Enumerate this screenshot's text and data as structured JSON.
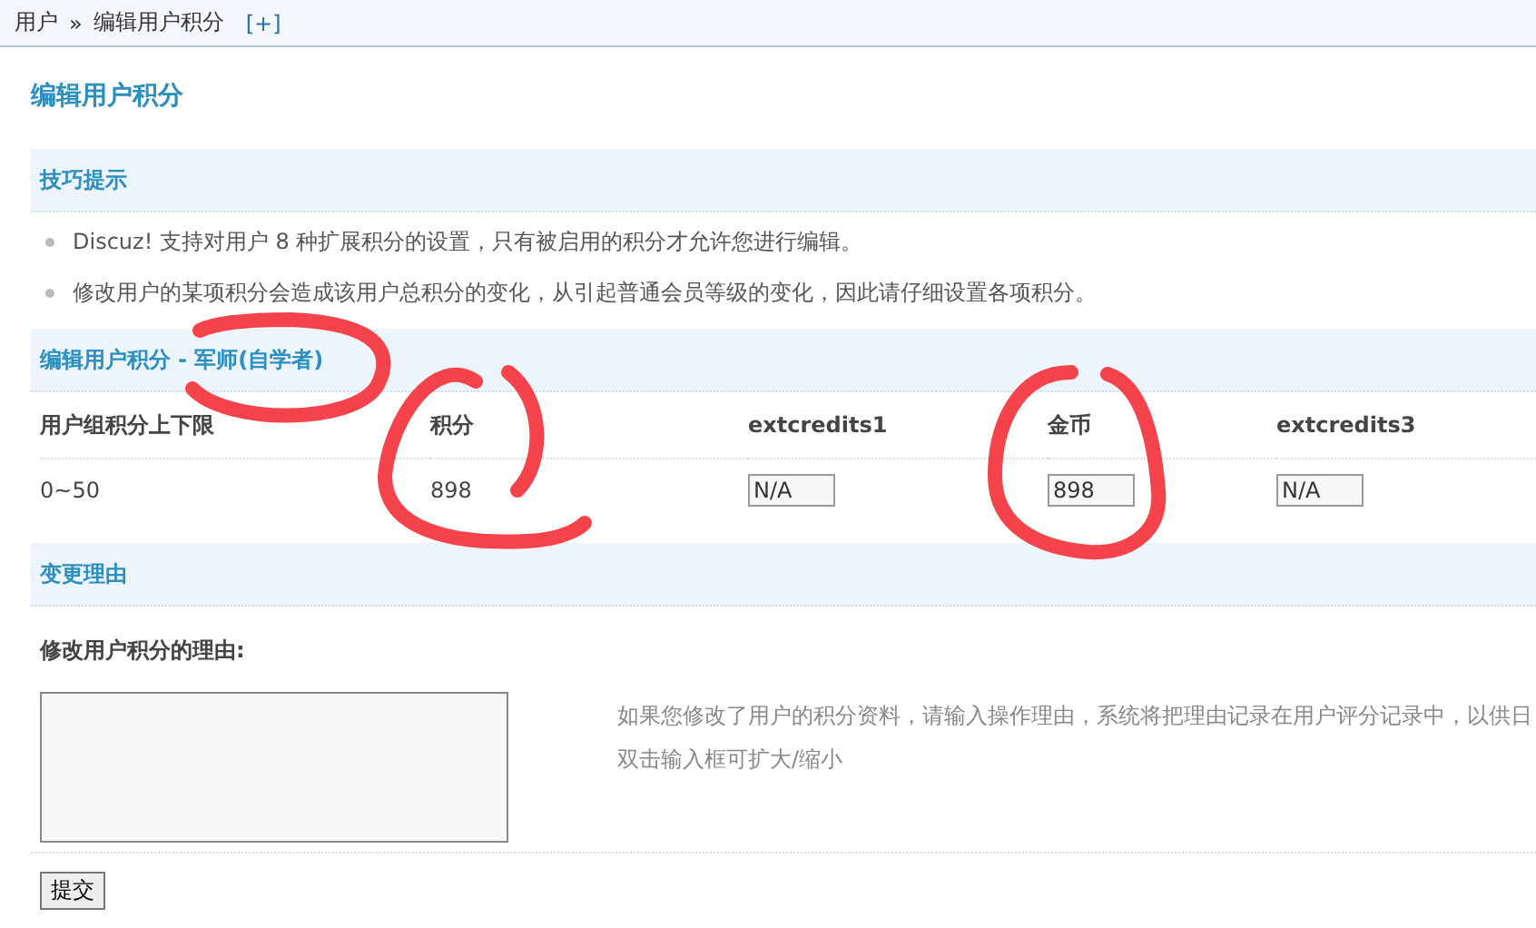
{
  "breadcrumb": {
    "items": [
      "用户",
      "编辑用户积分"
    ],
    "separator": "»",
    "add": "[+]"
  },
  "page_title": "编辑用户积分",
  "tips": {
    "title": "技巧提示",
    "items": [
      "Discuz! 支持对用户 8 种扩展积分的设置，只有被启用的积分才允许您进行编辑。",
      "修改用户的某项积分会造成该用户总积分的变化，从引起普通会员等级的变化，因此请仔细设置各项积分。"
    ]
  },
  "credits": {
    "title": "编辑用户积分",
    "user": "- 军师(自学者)",
    "columns": [
      "用户组积分上下限",
      "积分",
      "extcredits1",
      "金币",
      "extcredits3"
    ],
    "row": [
      {
        "kind": "text",
        "value": "0~50"
      },
      {
        "kind": "text",
        "value": "898"
      },
      {
        "kind": "input",
        "value": "N/A"
      },
      {
        "kind": "input",
        "value": "898"
      },
      {
        "kind": "input",
        "value": "N/A"
      }
    ]
  },
  "reason": {
    "title": "变更理由",
    "label": "修改用户积分的理由:",
    "hint": [
      "如果您修改了用户的积分资料，请输入操作理由，系统将把理由记录在用户评分记录中，以供日",
      "双击输入框可扩大/缩小"
    ]
  },
  "submit": "提交",
  "annotations": [
    {
      "kind": "circle"
    },
    {
      "kind": "circle"
    },
    {
      "kind": "circle"
    }
  ]
}
